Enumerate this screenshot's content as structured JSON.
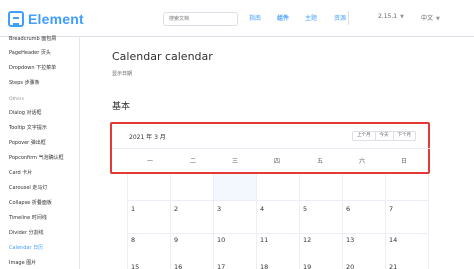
{
  "header": {
    "logo_text": "Element",
    "search_placeholder": "搜索文档",
    "nav": [
      "指南",
      "组件",
      "主题",
      "资源"
    ],
    "version": "2.15.1",
    "language": "中文"
  },
  "sidebar": {
    "items_top": [
      "Breadcrumb 面包屑",
      "PageHeader 页头",
      "Dropdown 下拉菜单",
      "Steps 步骤条"
    ],
    "group": "Others",
    "items_bottom": [
      "Dialog 对话框",
      "Tooltip 文字提示",
      "Popover 弹出框",
      "Popconfirm 气泡确认框",
      "Card 卡片",
      "Carousel 走马灯",
      "Collapse 折叠面板",
      "Timeline 时间线",
      "Divider 分割线",
      "Calendar 日历",
      "Image 图片"
    ],
    "active_item": "Calendar 日历"
  },
  "main": {
    "title": "Calendar calendar",
    "subtitle": "显示日期",
    "section_title": "基本",
    "calendar": {
      "month_label": "2021 年 3 月",
      "buttons": [
        "上个月",
        "今天",
        "下个月"
      ],
      "weekdays": [
        "一",
        "二",
        "三",
        "四",
        "五",
        "六",
        "日"
      ],
      "rows": [
        [
          "1",
          "2",
          "3",
          "4",
          "5",
          "6",
          "7"
        ],
        [
          "8",
          "9",
          "10",
          "11",
          "12",
          "13",
          "14"
        ],
        [
          "15",
          "16",
          "17",
          "18",
          "19",
          "20",
          "21"
        ]
      ]
    }
  },
  "colors": {
    "brand": "#409EFF",
    "highlight_border": "#e53935",
    "today_bg": "#f2f8fe"
  }
}
